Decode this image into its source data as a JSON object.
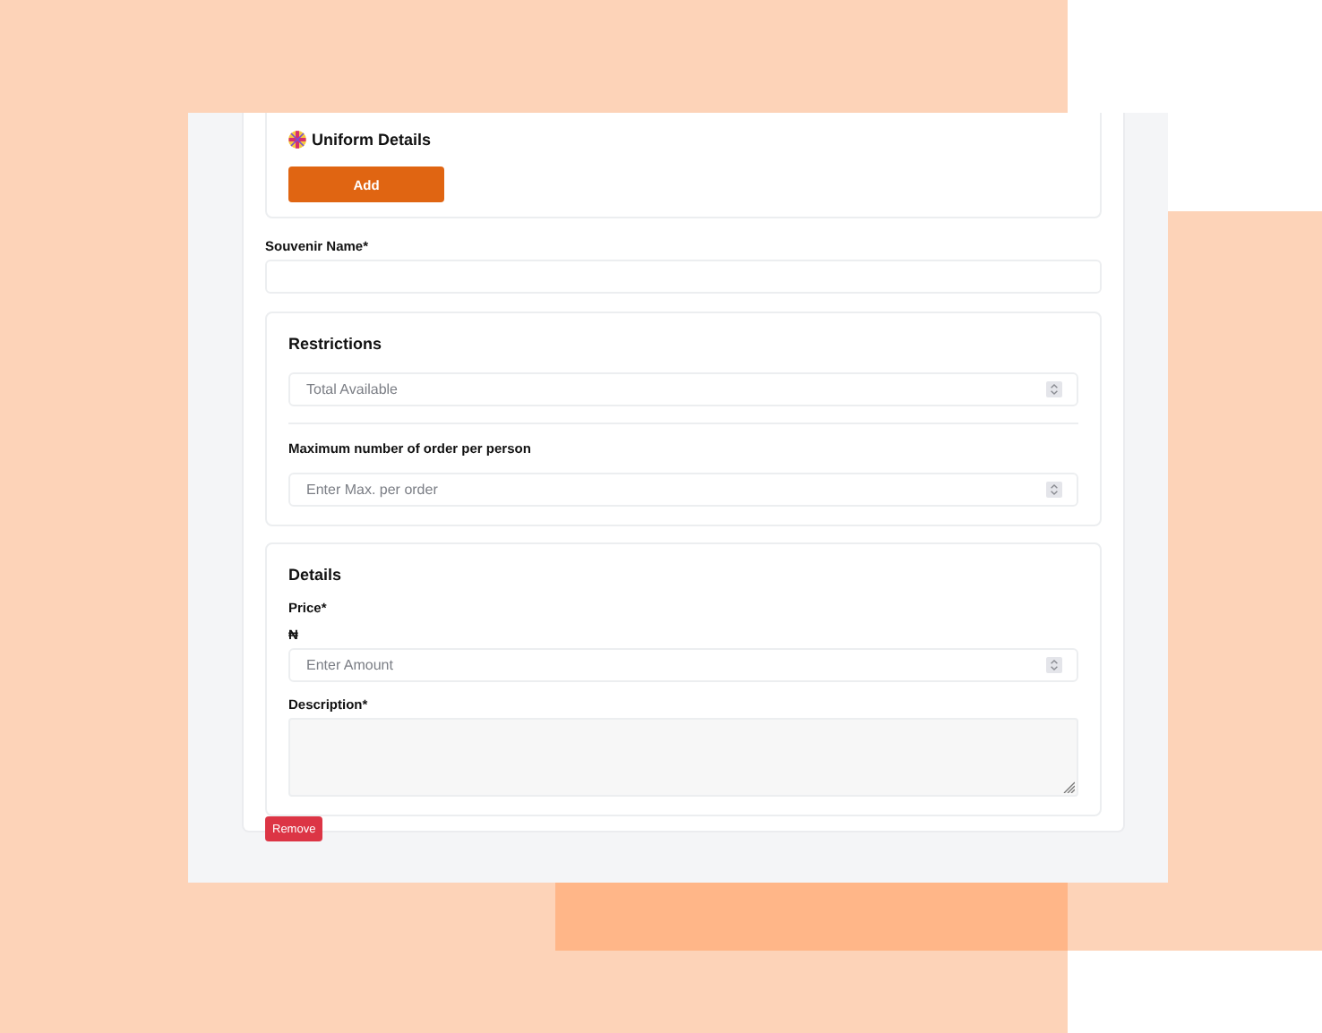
{
  "uniform_details": {
    "title": "Uniform Details",
    "add_button": "Add"
  },
  "souvenir_name": {
    "label": "Souvenir Name*"
  },
  "restrictions": {
    "title": "Restrictions",
    "total_available": {
      "placeholder": "Total Available"
    },
    "max_per_person": {
      "label": "Maximum number of order per person",
      "placeholder": "Enter Max. per order"
    }
  },
  "details": {
    "title": "Details",
    "price": {
      "label": "Price*",
      "currency": "₦",
      "placeholder": "Enter Amount"
    },
    "description": {
      "label": "Description*"
    }
  },
  "remove_button": "Remove"
}
